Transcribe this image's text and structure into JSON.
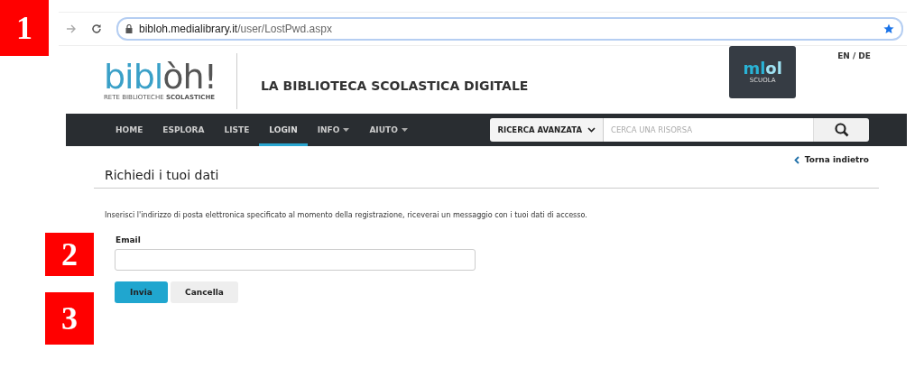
{
  "annotations": [
    "1",
    "2",
    "3"
  ],
  "browser": {
    "url_host": "bibloh.medialibrary.it",
    "url_path": "/user/LostPwd.aspx",
    "bookmarked": true
  },
  "header": {
    "logo_parts": [
      "bibl",
      "òh!"
    ],
    "logo_tagline_parts": [
      "RETE BIBLIOTECHE",
      "SCOLASTICHE"
    ],
    "site_title": "LA BIBLIOTECA SCOLASTICA DIGITALE",
    "partner_logo_parts": [
      "ml",
      "ol"
    ],
    "partner_logo_sub": "SCUOLA",
    "language_switch": "EN / DE"
  },
  "nav": {
    "items": [
      {
        "label": "HOME",
        "selected": false,
        "has_menu": false
      },
      {
        "label": "ESPLORA",
        "selected": false,
        "has_menu": false
      },
      {
        "label": "LISTE",
        "selected": false,
        "has_menu": false
      },
      {
        "label": "LOGIN",
        "selected": true,
        "has_menu": false
      },
      {
        "label": "INFO",
        "selected": false,
        "has_menu": true
      },
      {
        "label": "AIUTO",
        "selected": false,
        "has_menu": true
      }
    ],
    "advanced_search": "RICERCA AVANZATA",
    "search_placeholder": "CERCA UNA RISORSA"
  },
  "back_link": "Torna indietro",
  "page_title": "Richiedi i tuoi dati",
  "instructions": "Inserisci l'indirizzo di posta elettronica specificato al momento della registrazione, riceverai un messaggio con i tuoi dati di accesso.",
  "form": {
    "email_label": "Email",
    "buttons": [
      {
        "label": "Invia",
        "kind": "primary"
      },
      {
        "label": "Cancella",
        "kind": "secondary"
      }
    ]
  }
}
